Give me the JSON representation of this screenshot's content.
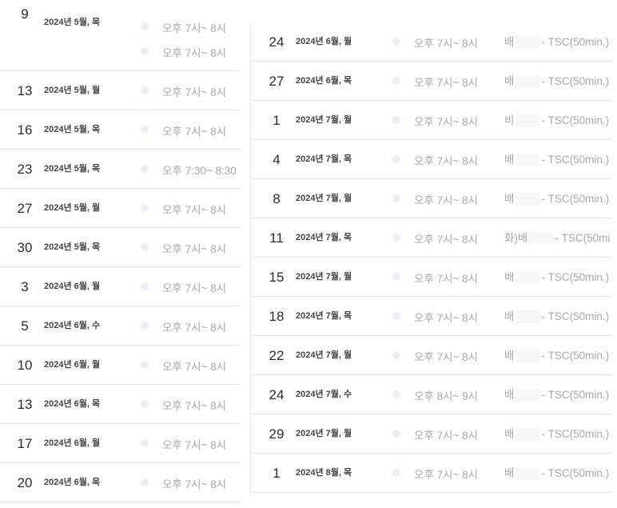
{
  "left_rows": [
    {
      "day": "9",
      "date": "2024년 5월, 목",
      "times": [
        "오후 7시~ 8시",
        "오후 7시~ 8시"
      ]
    },
    {
      "day": "13",
      "date": "2024년 5월, 월",
      "times": [
        "오후 7시~ 8시"
      ]
    },
    {
      "day": "16",
      "date": "2024년 5월, 목",
      "times": [
        "오후 7시~ 8시"
      ]
    },
    {
      "day": "23",
      "date": "2024년 5월, 목",
      "times": [
        "오후 7:30~ 8:30"
      ]
    },
    {
      "day": "27",
      "date": "2024년 5월, 월",
      "times": [
        "오후 7시~ 8시"
      ]
    },
    {
      "day": "30",
      "date": "2024년 5월, 목",
      "times": [
        "오후 7시~ 8시"
      ]
    },
    {
      "day": "3",
      "date": "2024년 6월, 월",
      "times": [
        "오후 7시~ 8시"
      ]
    },
    {
      "day": "5",
      "date": "2024년 6월, 수",
      "times": [
        "오후 7시~ 8시"
      ]
    },
    {
      "day": "10",
      "date": "2024년 6월, 월",
      "times": [
        "오후 7시~ 8시"
      ]
    },
    {
      "day": "13",
      "date": "2024년 6월, 목",
      "times": [
        "오후 7시~ 8시"
      ]
    },
    {
      "day": "17",
      "date": "2024년 6월, 월",
      "times": [
        "오후 7시~ 8시"
      ]
    },
    {
      "day": "20",
      "date": "2024년 6월, 목",
      "times": [
        "오후 7시~ 8시"
      ]
    }
  ],
  "right_rows": [
    {
      "day": "24",
      "date": "2024년 6월, 월",
      "time": "오후 7시~ 8시",
      "desc_prefix": "배",
      "desc_suffix": "- TSC(50min.)"
    },
    {
      "day": "27",
      "date": "2024년 6월, 목",
      "time": "오후 7시~ 8시",
      "desc_prefix": "배",
      "desc_suffix": "- TSC(50min.)"
    },
    {
      "day": "1",
      "date": "2024년 7월, 월",
      "time": "오후 7시~ 8시",
      "desc_prefix": "비",
      "desc_suffix": "- TSC(50min.)"
    },
    {
      "day": "4",
      "date": "2024년 7월, 목",
      "time": "오후 7시~ 8시",
      "desc_prefix": "배",
      "desc_suffix": "- TSC(50min.)"
    },
    {
      "day": "8",
      "date": "2024년 7월, 월",
      "time": "오후 7시~ 8시",
      "desc_prefix": "배",
      "desc_suffix": "- TSC(50min.)"
    },
    {
      "day": "11",
      "date": "2024년 7월, 목",
      "time": "오후 7시~ 8시",
      "desc_prefix": "화)배",
      "desc_suffix": "- TSC(50mi"
    },
    {
      "day": "15",
      "date": "2024년 7월, 월",
      "time": "오후 7시~ 8시",
      "desc_prefix": "배",
      "desc_suffix": "- TSC(50min.)"
    },
    {
      "day": "18",
      "date": "2024년 7월, 목",
      "time": "오후 7시~ 8시",
      "desc_prefix": "배",
      "desc_suffix": "- TSC(50min.)"
    },
    {
      "day": "22",
      "date": "2024년 7월, 월",
      "time": "오후 7시~ 8시",
      "desc_prefix": "배",
      "desc_suffix": "- TSC(50min.)"
    },
    {
      "day": "24",
      "date": "2024년 7월, 수",
      "time": "오후 8시~ 9시",
      "desc_prefix": "배",
      "desc_suffix": "- TSC(50min.)"
    },
    {
      "day": "29",
      "date": "2024년 7월, 월",
      "time": "오후 7시~ 8시",
      "desc_prefix": "배",
      "desc_suffix": "- TSC(50min.)"
    },
    {
      "day": "1",
      "date": "2024년 8월, 목",
      "time": "오후 7시~ 8시",
      "desc_prefix": "배",
      "desc_suffix": "- TSC(50min.)"
    }
  ]
}
